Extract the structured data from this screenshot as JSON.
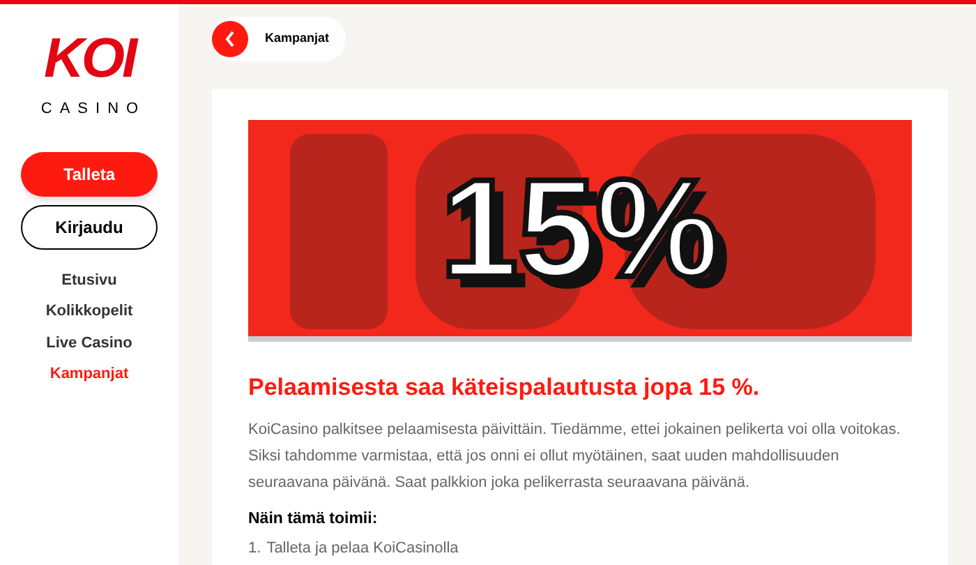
{
  "logo": {
    "mark": "KOI",
    "word": "CASINO"
  },
  "sidebar": {
    "buttons": [
      {
        "label": "Talleta",
        "kind": "primary"
      },
      {
        "label": "Kirjaudu",
        "kind": "outline"
      }
    ],
    "items": [
      {
        "label": "Etusivu",
        "selected": false
      },
      {
        "label": "Kolikkopelit",
        "selected": false
      },
      {
        "label": "Live Casino",
        "selected": false
      },
      {
        "label": "Kampanjat",
        "selected": true
      }
    ]
  },
  "breadcrumb": {
    "label": "Kampanjat"
  },
  "banner": {
    "headline": "15%"
  },
  "article": {
    "heading": "Pelaamisesta saa käteispalautusta jopa 15 %.",
    "paragraph": "KoiCasino palkitsee pelaamisesta päivittäin. Tiedämme, ettei jokainen pelikerta voi olla voitokas. Siksi tahdomme varmistaa, että jos onni ei ollut myötäinen, saat uuden mahdollisuuden seuraavana päivänä. Saat palkkion joka pelikerrasta seuraavana päivänä.",
    "subheading": "Näin tämä toimii:",
    "steps": [
      {
        "number": "1.",
        "text": "Talleta ja pelaa KoiCasinolla"
      }
    ]
  }
}
